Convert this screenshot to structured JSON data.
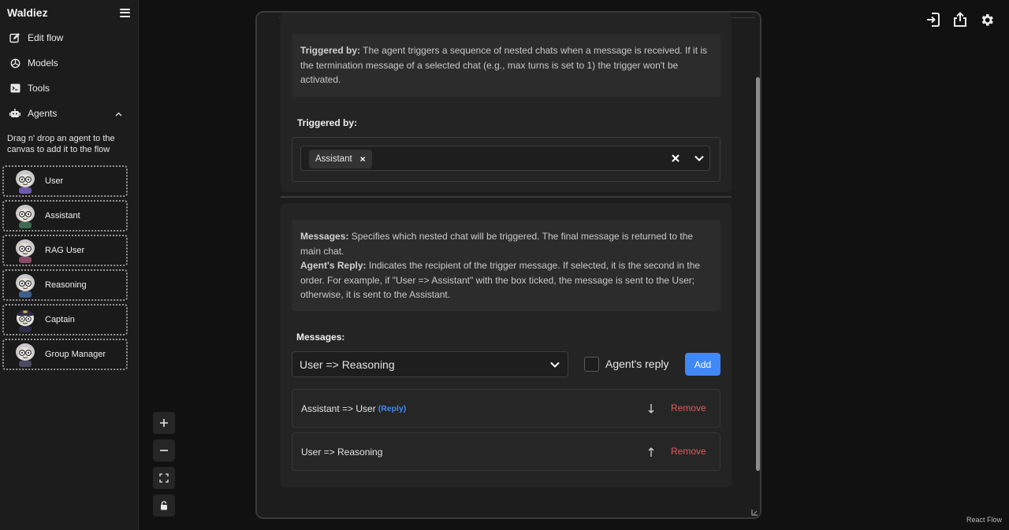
{
  "app": {
    "title": "Waldiez"
  },
  "sidebar": {
    "items": [
      {
        "label": "Edit flow",
        "icon": "edit-icon"
      },
      {
        "label": "Models",
        "icon": "models-icon"
      },
      {
        "label": "Tools",
        "icon": "terminal-icon"
      },
      {
        "label": "Agents",
        "icon": "robot-icon",
        "expanded": true
      }
    ],
    "hint": "Drag n' drop an agent to the canvas to add it to the flow",
    "agents": [
      {
        "label": "User",
        "avatar": "user-avatar-icon"
      },
      {
        "label": "Assistant",
        "avatar": "assistant-avatar-icon"
      },
      {
        "label": "RAG User",
        "avatar": "rag-user-avatar-icon"
      },
      {
        "label": "Reasoning",
        "avatar": "reasoning-avatar-icon"
      },
      {
        "label": "Captain",
        "avatar": "captain-avatar-icon"
      },
      {
        "label": "Group Manager",
        "avatar": "group-manager-avatar-icon"
      }
    ]
  },
  "toolbar": {
    "icons": [
      "import-icon",
      "share-icon",
      "settings-icon"
    ]
  },
  "canvas": {
    "attribution": "React Flow",
    "zoom_controls": [
      "zoom-in-icon",
      "zoom-out-icon",
      "fit-view-icon",
      "lock-icon"
    ]
  },
  "nested_chats": {
    "trigger_info": {
      "bold": "Triggered by:",
      "text": " The agent triggers a sequence of nested chats when a message is received. If it is the termination message of a selected chat (e.g., max turns is set to 1) the trigger won't be activated."
    },
    "triggered_by_label": "Triggered by:",
    "triggered_by_selected": [
      "Assistant"
    ],
    "messages_info": {
      "messages_bold": "Messages:",
      "messages_text": " Specifies which nested chat will be triggered. The final message is returned to the main chat.",
      "reply_bold": "Agent's Reply:",
      "reply_text": " Indicates the recipient of the trigger message. If selected, it is the second in the order. For example, if \"User => Assistant\" with the box ticked, the message is sent to the User; otherwise, it is sent to the Assistant."
    },
    "messages_label": "Messages:",
    "message_select_value": "User => Reasoning",
    "agent_reply_label": "Agent's reply",
    "agent_reply_checked": false,
    "add_label": "Add",
    "message_rows": [
      {
        "text": "Assistant => User",
        "reply_tag": "(Reply)",
        "move": "move-down-icon",
        "remove": "Remove"
      },
      {
        "text": "User => Reasoning",
        "reply_tag": "",
        "move": "move-up-icon",
        "remove": "Remove"
      }
    ]
  },
  "colors": {
    "accent": "#3f88f5",
    "danger": "#e05b5b",
    "background": "#111111",
    "sidebar": "#1c1c1c",
    "modal": "#1d1d1d"
  }
}
